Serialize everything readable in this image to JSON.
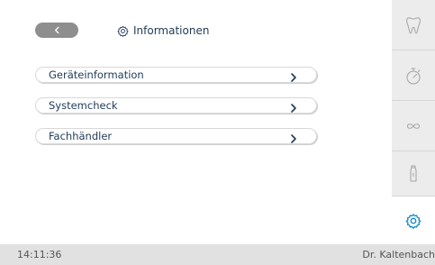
{
  "header": {
    "title": "Informationen",
    "back_icon": "chevron-left-icon",
    "title_icon": "gear-icon"
  },
  "menu": {
    "items": [
      {
        "label": "Geräteinformation"
      },
      {
        "label": "Systemcheck"
      },
      {
        "label": "Fachhändler"
      }
    ]
  },
  "sidebar": {
    "items": [
      {
        "icon": "tooth-icon"
      },
      {
        "icon": "stopwatch-icon"
      },
      {
        "icon": "infinity-icon"
      },
      {
        "icon": "bottle-icon"
      },
      {
        "icon": "gear-icon",
        "active": true
      }
    ]
  },
  "status": {
    "time": "14:11:36",
    "user": "Dr. Kaltenbach"
  },
  "colors": {
    "accent": "#0a87c9",
    "text": "#1f3b57",
    "back_button": "#8e8e8e",
    "sidebar_bg": "#ececec",
    "status_bg": "#e1e1e1"
  }
}
